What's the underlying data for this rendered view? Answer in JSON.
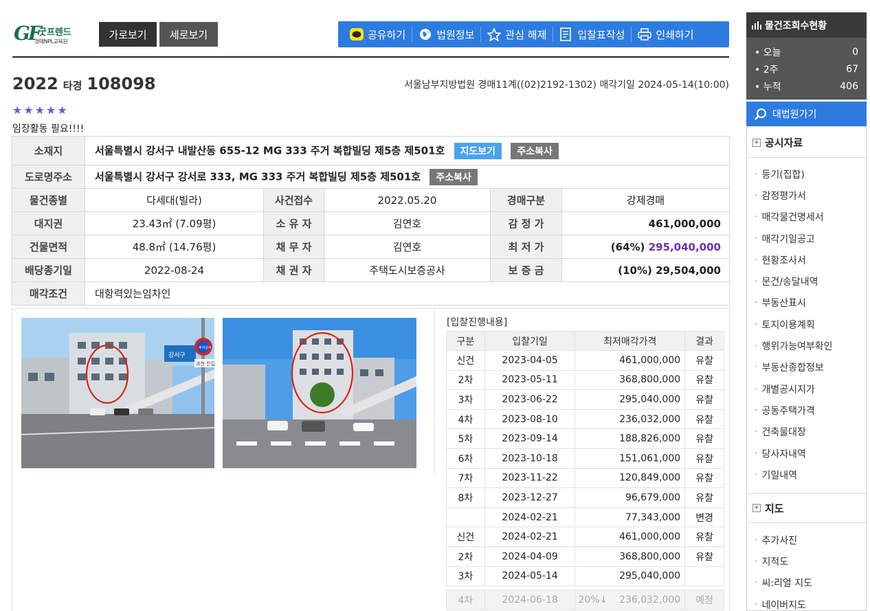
{
  "logo": {
    "mark": "GF",
    "name": "굿프렌드",
    "sub": "경매NPL교육원"
  },
  "view_buttons": {
    "horizontal": "가로보기",
    "vertical": "세로보기"
  },
  "toolbar": {
    "share": "공유하기",
    "court_info": "법원정보",
    "unfavorite": "관심 해제",
    "bid_form": "입찰표작성",
    "print": "인쇄하기"
  },
  "case": {
    "year": "2022",
    "type": "타경",
    "number": "108098",
    "court_info": "서울남부지방법원 경매11계((02)2192-1302) 매각기일 2024-05-14(10:00)",
    "stars": "★★★★★",
    "memo": "임장활동 필요!!!!"
  },
  "info": {
    "location_label": "소재지",
    "location": "서울특별시 강서구 내발산동 655-12 MG 333 주거 복합빌딩 제5층 제501호",
    "map_btn": "지도보기",
    "copy_btn": "주소복사",
    "road_label": "도로명주소",
    "road": "서울특별시 강서구 강서로 333, MG 333 주거 복합빌딩 제5층 제501호",
    "copy_btn2": "주소복사",
    "type_label": "물건종별",
    "type": "다세대(빌라)",
    "received_label": "사건접수",
    "received": "2022.05.20",
    "auction_type_label": "경매구분",
    "auction_type": "강제경매",
    "land_label": "대지권",
    "land": "23.43㎡ (7.09평)",
    "owner_label": "소 유 자",
    "owner": "김연호",
    "appraisal_label": "감 정 가",
    "appraisal": "461,000,000",
    "building_label": "건물면적",
    "building": "48.8㎡ (14.76평)",
    "debtor_label": "채 무 자",
    "debtor": "김연호",
    "min_label": "최 저 가",
    "min_pct": "(64%)",
    "min_price": "295,040,000",
    "deadline_label": "배당종기일",
    "deadline": "2022-08-24",
    "creditor_label": "채 권 자",
    "creditor": "주택도시보증공사",
    "deposit_label": "보 증 금",
    "deposit": "(10%) 29,504,000",
    "condition_label": "매각조건",
    "condition": "대항력있는임차인"
  },
  "bids": {
    "title": "[입찰진행내용]",
    "headers": [
      "구분",
      "입찰기일",
      "최저매각가격",
      "결과"
    ],
    "rows": [
      {
        "round": "신건",
        "date": "2023-04-05",
        "price": "461,000,000",
        "result": "유찰"
      },
      {
        "round": "2차",
        "date": "2023-05-11",
        "price": "368,800,000",
        "result": "유찰"
      },
      {
        "round": "3차",
        "date": "2023-06-22",
        "price": "295,040,000",
        "result": "유찰"
      },
      {
        "round": "4차",
        "date": "2023-08-10",
        "price": "236,032,000",
        "result": "유찰"
      },
      {
        "round": "5차",
        "date": "2023-09-14",
        "price": "188,826,000",
        "result": "유찰"
      },
      {
        "round": "6차",
        "date": "2023-10-18",
        "price": "151,061,000",
        "result": "유찰"
      },
      {
        "round": "7차",
        "date": "2023-11-22",
        "price": "120,849,000",
        "result": "유찰"
      },
      {
        "round": "8차",
        "date": "2023-12-27",
        "price": "96,679,000",
        "result": "유찰"
      },
      {
        "round": "",
        "date": "2024-02-21",
        "price": "77,343,000",
        "result": "변경"
      },
      {
        "round": "신건",
        "date": "2024-02-21",
        "price": "461,000,000",
        "result": "유찰"
      },
      {
        "round": "2차",
        "date": "2024-04-09",
        "price": "368,800,000",
        "result": "유찰"
      },
      {
        "round": "3차",
        "date": "2024-05-14",
        "price": "295,040,000",
        "result": ""
      }
    ],
    "future": {
      "round": "4차",
      "date": "2024-06-18",
      "pct": "20%↓",
      "price": "236,032,000",
      "result": "예정"
    }
  },
  "photo_signs": {
    "sign1": "강서구",
    "sign2": "주차금지",
    "sign3": "과천 진입"
  },
  "sidebar": {
    "title": "물건조회수현황",
    "stats": [
      {
        "label": "오늘",
        "value": "0"
      },
      {
        "label": "2주",
        "value": "67"
      },
      {
        "label": "누적",
        "value": "406"
      }
    ],
    "court_link": "대법원가기",
    "public_title": "공시자료",
    "public_items": [
      "등기(집합)",
      "감정평가서",
      "매각물건명세서",
      "매각기일공고",
      "현황조사서",
      "문건/송달내역",
      "부동산표시",
      "토지이용계획",
      "행위가능여부확인",
      "부동산종합정보",
      "개별공시지가",
      "공동주택가격",
      "건축물대장",
      "당사자내역",
      "기일내역"
    ],
    "map_title": "지도",
    "map_items": [
      "추가사진",
      "지적도",
      "씨:리얼 지도",
      "네이버지도"
    ]
  },
  "colors": {
    "accent": "#2e7be0",
    "purple": "#6a2fb8",
    "red": "#e03030",
    "dark": "#3a3a3a"
  }
}
